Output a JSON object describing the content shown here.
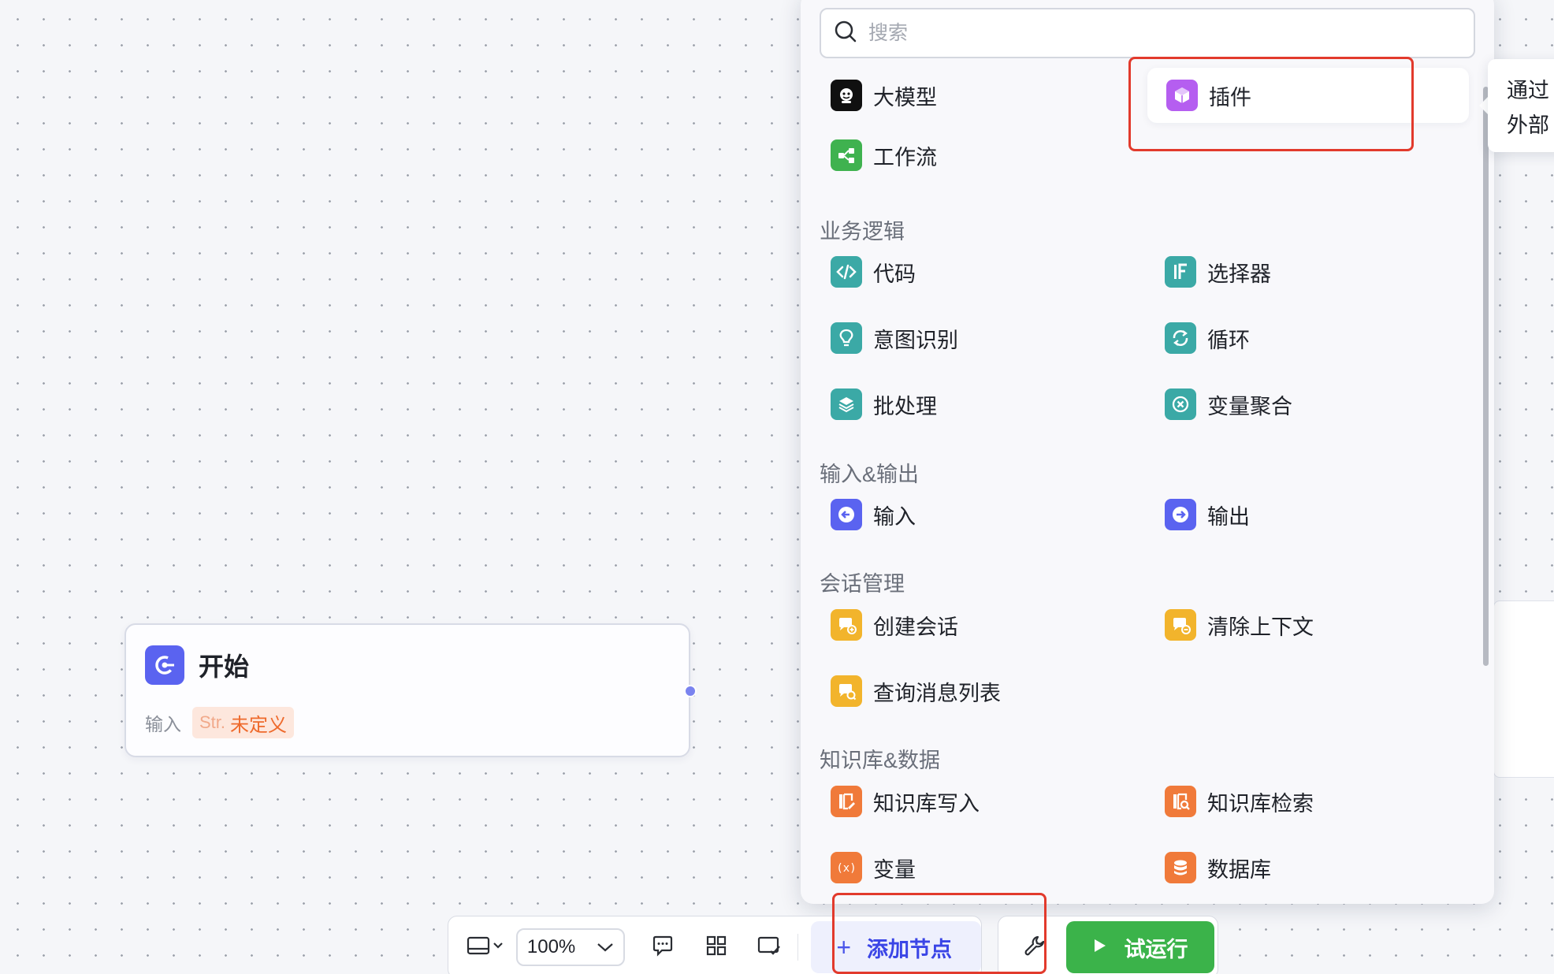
{
  "search": {
    "placeholder": "搜索",
    "value": ""
  },
  "top_items": [
    {
      "label": "大模型",
      "icon": "llm-icon",
      "color": "#101010"
    },
    {
      "label": "插件",
      "icon": "plugin-cube-icon",
      "color": "#b55ef0"
    },
    {
      "label": "工作流",
      "icon": "workflow-icon",
      "color": "#3fb24f"
    }
  ],
  "sections": {
    "business_logic": {
      "title": "业务逻辑",
      "items": [
        {
          "label": "代码",
          "icon": "code-icon"
        },
        {
          "label": "选择器",
          "icon": "if-selector-icon"
        },
        {
          "label": "意图识别",
          "icon": "intent-bulb-icon"
        },
        {
          "label": "循环",
          "icon": "loop-icon"
        },
        {
          "label": "批处理",
          "icon": "batch-layers-icon"
        },
        {
          "label": "变量聚合",
          "icon": "variable-merge-icon"
        }
      ]
    },
    "io": {
      "title": "输入&输出",
      "items": [
        {
          "label": "输入",
          "icon": "input-icon"
        },
        {
          "label": "输出",
          "icon": "output-icon"
        }
      ]
    },
    "conversation": {
      "title": "会话管理",
      "items": [
        {
          "label": "创建会话",
          "icon": "create-chat-icon"
        },
        {
          "label": "清除上下文",
          "icon": "clear-context-icon"
        },
        {
          "label": "查询消息列表",
          "icon": "query-messages-icon"
        }
      ]
    },
    "knowledge": {
      "title": "知识库&数据",
      "items": [
        {
          "label": "知识库写入",
          "icon": "kb-write-icon"
        },
        {
          "label": "知识库检索",
          "icon": "kb-search-icon"
        },
        {
          "label": "变量",
          "icon": "variable-icon"
        },
        {
          "label": "数据库",
          "icon": "database-icon"
        }
      ]
    }
  },
  "tooltip": {
    "line1": "通过",
    "line2": "外部"
  },
  "start_node": {
    "title": "开始",
    "input_label": "输入",
    "param_type": "Str.",
    "param_value": "未定义"
  },
  "toolbar": {
    "zoom": "100%",
    "add_node_label": "添加节点",
    "run_label": "试运行"
  },
  "colors": {
    "accent": "#4a55ea",
    "run_green": "#3bb34a",
    "highlight_red": "#e23a2c"
  }
}
